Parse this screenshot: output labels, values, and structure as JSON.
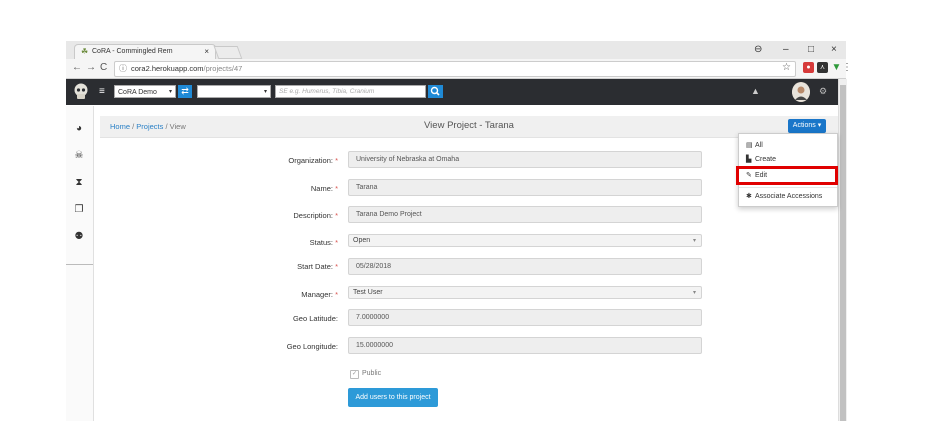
{
  "browser": {
    "tab_title": "CoRA - Commingled Rem",
    "tab_close": "×",
    "url_host": "cora2.herokuapp.com",
    "url_path": "/projects/47",
    "nav_back": "←",
    "nav_forward": "→",
    "nav_reload": "C",
    "star": "☆",
    "win_account": "⊖",
    "win_minimize": "–",
    "win_maximize": "□",
    "win_close": "×",
    "menu": "⋮"
  },
  "appbar": {
    "hamburger": "≡",
    "org_select": "CoRA Demo",
    "project_select": "",
    "search_placeholder": "SE e.g. Humerus, Tibia, Cranium",
    "swap": "⇄"
  },
  "breadcrumb": {
    "home": "Home",
    "sep1": " / ",
    "projects": "Projects",
    "sep2": " / ",
    "current": "View"
  },
  "page_title": "View Project - Tarana",
  "actions": {
    "label": "Actions",
    "caret": "▾",
    "items": [
      {
        "label": "All",
        "icon": "▤"
      },
      {
        "label": "Create",
        "icon": "▙"
      },
      {
        "label": "Edit",
        "icon": "✎"
      },
      {
        "label": "Associate Accessions",
        "icon": "✱"
      }
    ]
  },
  "form": {
    "organization": {
      "label": "Organization:",
      "value": "University of Nebraska at Omaha",
      "required": "*"
    },
    "name": {
      "label": "Name:",
      "value": "Tarana",
      "required": "*"
    },
    "description": {
      "label": "Description:",
      "value": "Tarana Demo Project",
      "required": "*"
    },
    "status": {
      "label": "Status:",
      "value": "Open",
      "required": "*"
    },
    "start_date": {
      "label": "Start Date:",
      "value": "05/28/2018",
      "required": "*"
    },
    "manager": {
      "label": "Manager:",
      "value": "Test User",
      "required": "*"
    },
    "geo_latitude": {
      "label": "Geo Latitude:",
      "value": "7.0000000"
    },
    "geo_longitude": {
      "label": "Geo Longitude:",
      "value": "15.0000000"
    },
    "public_label": "Public",
    "add_users_label": "Add users to this project"
  },
  "colors": {
    "navbar": "#2b2d31",
    "primary": "#1a76c9",
    "highlight": "#e00000"
  }
}
